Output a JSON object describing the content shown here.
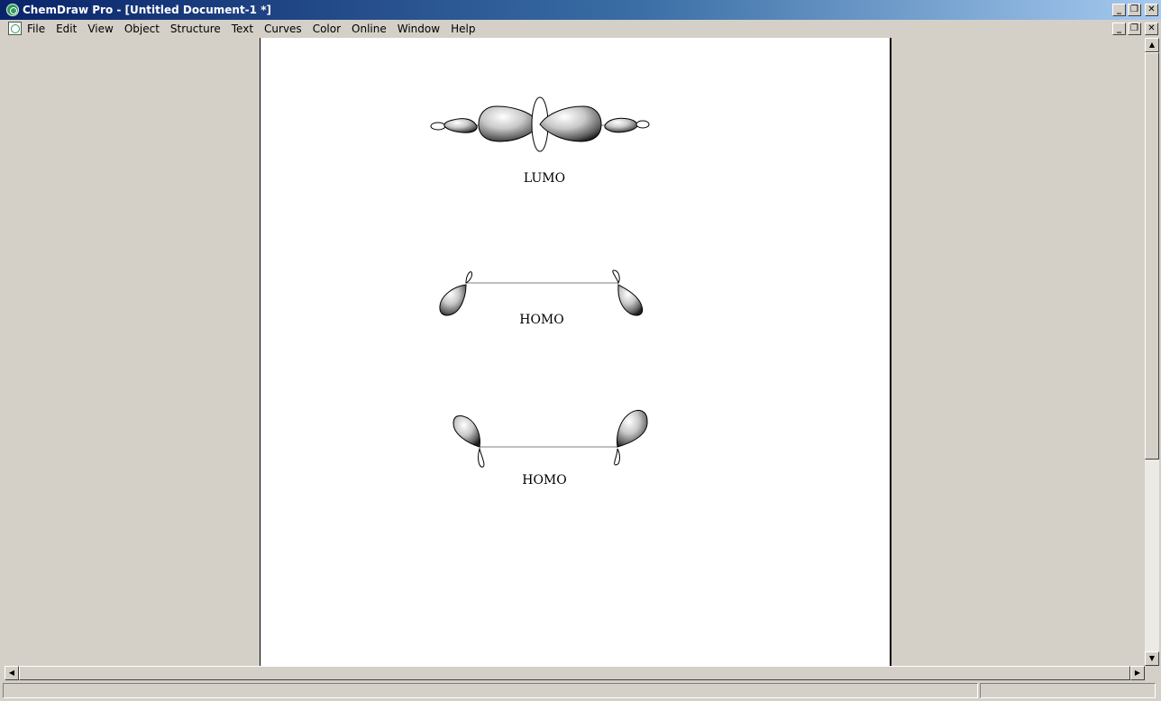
{
  "window": {
    "title": "ChemDraw Pro - [Untitled Document-1 *]",
    "minimize_glyph": "_",
    "restore_glyph": "❐",
    "close_glyph": "✕"
  },
  "menu": {
    "items": [
      "File",
      "Edit",
      "View",
      "Object",
      "Structure",
      "Text",
      "Curves",
      "Color",
      "Online",
      "Window",
      "Help"
    ]
  },
  "document": {
    "labels": {
      "lumo": "LUMO",
      "homo_1": "HOMO",
      "homo_2": "HOMO"
    }
  },
  "scroll": {
    "up": "▲",
    "down": "▼",
    "left": "◀",
    "right": "▶"
  }
}
